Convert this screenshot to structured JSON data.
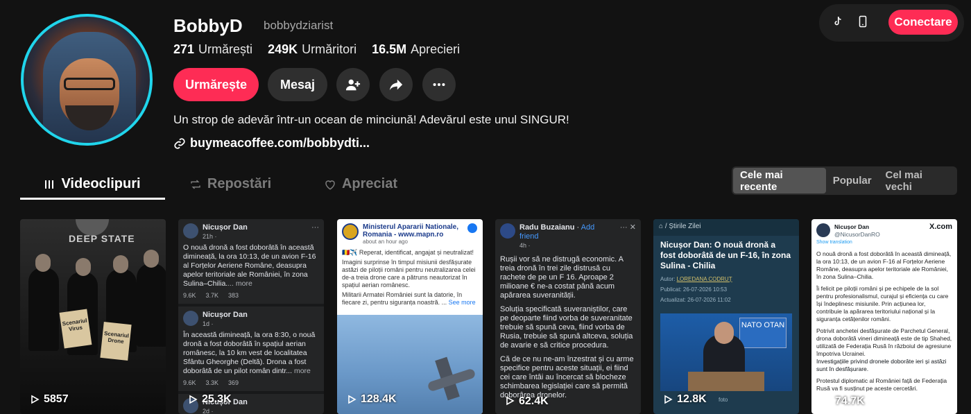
{
  "profile": {
    "name": "BobbyD",
    "handle": "bobbydziarist",
    "stats": [
      {
        "value": "271",
        "label": "Urmărești"
      },
      {
        "value": "249K",
        "label": "Urmăritori"
      },
      {
        "value": "16.5M",
        "label": "Aprecieri"
      }
    ],
    "bio": "Un strop de adevăr într-un ocean de minciună! Adevărul este unul SINGUR!",
    "link": "buymeacoffee.com/bobbydti..."
  },
  "actions": {
    "follow": "Urmărește",
    "message": "Mesaj",
    "add_friend_icon": "add-user-icon",
    "share_icon": "share-icon",
    "more_icon": "more-icon"
  },
  "topbar": {
    "connect": "Conectare",
    "tiktok_icon": "tiktok-icon",
    "phone_icon": "phone-icon"
  },
  "tabs": [
    {
      "label": "Videoclipuri",
      "icon": "grid-icon",
      "active": true
    },
    {
      "label": "Repostări",
      "icon": "repost-icon",
      "active": false
    },
    {
      "label": "Apreciat",
      "icon": "heart-icon",
      "active": false
    }
  ],
  "sort": [
    {
      "label": "Cele mai recente",
      "active": true
    },
    {
      "label": "Popular",
      "active": false
    },
    {
      "label": "Cel mai vechi",
      "active": false
    }
  ],
  "videos": [
    {
      "views": "5857",
      "overlay": "DEEP STATE",
      "paper1": "Scenariul Virus",
      "paper2": "Scenariul Drone"
    },
    {
      "views": "25.3K",
      "posts": [
        {
          "author": "Nicușor Dan",
          "time": "21h ·",
          "text": "O nouă dronă a fost doborâtă în această dimineață, la ora 10:13, de un avion F-16 al Forțelor Aeriene Române, deasupra apelor teritoriale ale României, în zona Sulina–Chilia.",
          "more": "... more",
          "likes": "9.6K",
          "comments": "3.7K",
          "shares": "383"
        },
        {
          "author": "Nicușor Dan",
          "time": "1d ·",
          "text": "În această dimineață, la ora 8:30, o nouă dronă a fost doborâtă în spațiul aerian românesc, la 10 km vest de localitatea Sfântu Gheorghe (Deltă). Drona a fost doborâtă de un pilot român dintr...",
          "more": "more",
          "likes": "9.6K",
          "comments": "3.3K",
          "shares": "369"
        },
        {
          "author": "Nicușor Dan",
          "time": "2d ·"
        }
      ]
    },
    {
      "views": "128.4K",
      "org": "Ministerul Apararii Nationale, Romania - www.mapn.ro",
      "date": "about an hour ago",
      "p1": "🇷🇴✈️ Reperat, identificat, angajat și neutralizat!",
      "p2": "Imagini surprinse în timpul misiunii desfășurate astăzi de piloții români pentru neutralizarea celei de-a treia drone care a pătruns neautorizat în spațiul aerian românesc.",
      "p3": "Militarii Armatei României sunt la datorie, în fiecare zi, pentru siguranța noastră. ...",
      "see_more": "See more"
    },
    {
      "views": "62.4K",
      "author": "Radu Buzaianu",
      "add_friend": "Add friend",
      "time": "4h ·",
      "p1": "Rușii vor să ne distrugă economic. A treia dronă în trei zile distrusă cu rachete de pe un F 16. Aproape 2 milioane € ne-a costat până acum apărarea suveranității.",
      "p2": "Soluția specificată suveraniștilor, care pe deoparte fiind vorba de suveranitate trebuie să spună ceva, fiind vorba de Rusia, trebuie să spună altceva, soluția de avarie e să critice procedura.",
      "p3": "Că de ce nu ne-am înzestrat și cu arme specifice pentru aceste situații, ei fiind cei care întâi au încercat să blocheze schimbarea legislației care să permită doborârea dronelor."
    },
    {
      "views": "12.8K",
      "section": "/ Știrile Zilei",
      "title": "Nicușor Dan: O nouă dronă a fost doborâtă de un F-16, în zona Sulina - Chilia",
      "author_label": "Autor:",
      "author": "LOREDANA CODRUȚ",
      "published": "Publicat: 26-07-2026 10:53",
      "updated": "Actualizat: 26-07-2026 11:02",
      "nato": "NATO OTAN",
      "caption": "foto"
    },
    {
      "views": "74.7K",
      "author": "Nicușor Dan",
      "handle": "@NicusorDanRO",
      "site": "X.com",
      "translate": "Show translation",
      "p1": "O nouă dronă a fost doborâtă în această dimineață, la ora 10:13, de un avion F-16 al Forțelor Aeriene Române, deasupra apelor teritoriale ale României, în zona Sulina–Chilia.",
      "p2": "Îi felicit pe piloții români și pe echipele de la sol pentru profesionalismul, curajul și eficiența cu care își îndeplinesc misiunile. Prin acțiunea lor, contribuie la apărarea teritoriului național și la siguranța cetățenilor români.",
      "p3": "Potrivit anchetei desfășurate de Parchetul General, drona doborâtă vineri dimineață este de tip Shahed, utilizată de Federația Rusă în războiul de agresiune împotriva Ucrainei.",
      "p4": "Investigațiile privind dronele doborâte ieri și astăzi sunt în desfășurare.",
      "p5": "Protestul diplomatic al României față de Federația Rusă va fi susținut pe aceste cercetări."
    }
  ],
  "colors": {
    "accent": "#fe2c55",
    "ring": "#20d5ec",
    "bg": "#121212"
  }
}
